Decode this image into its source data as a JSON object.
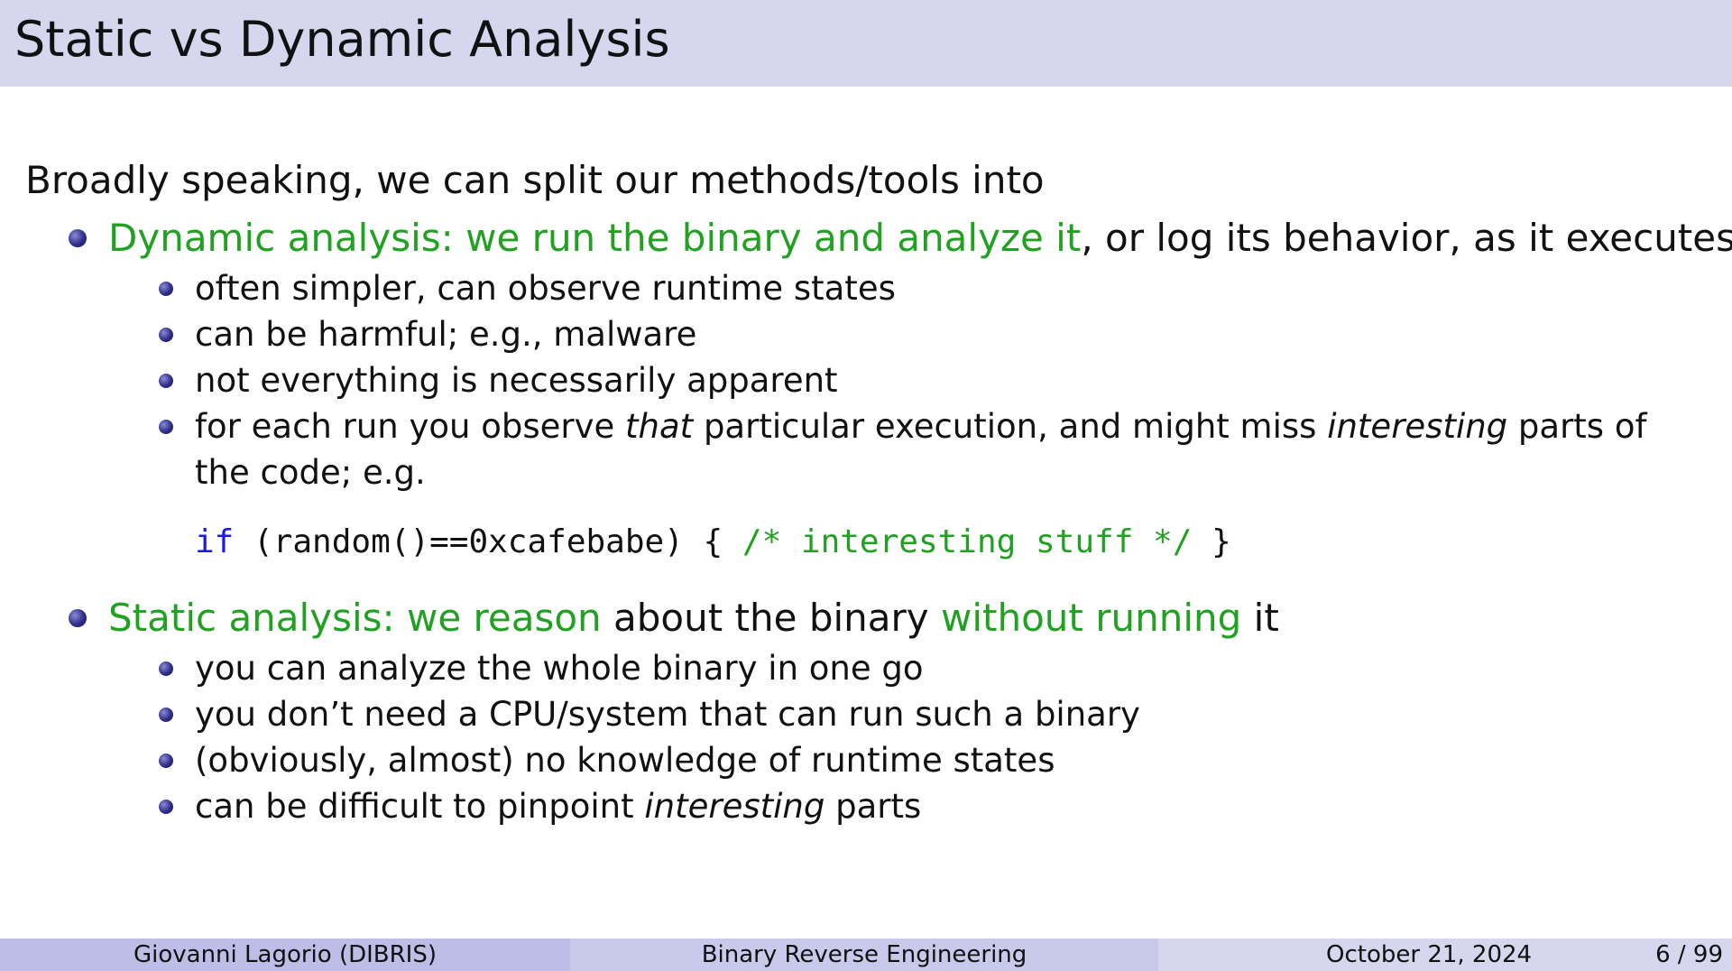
{
  "title": "Static vs Dynamic Analysis",
  "intro": "Broadly speaking, we can split our methods/tools into",
  "dynamic": {
    "label_colored": "Dynamic analysis: we run the binary and analyze it",
    "label_rest": ", or log its behavior, as it executes",
    "points": [
      "often simpler, can observe runtime states",
      "can be harmful; e.g., malware",
      "not everything is necessarily apparent"
    ],
    "last_point": {
      "part1": "for each run you observe ",
      "em1": "that",
      "part2": " particular execution, and might miss ",
      "em2": "interesting",
      "part3": " parts of the code; e.g."
    },
    "code": {
      "keyword": "if",
      "mid": " (random()==0xcafebabe) { ",
      "comment": "/* interesting stuff */",
      "end": " }"
    }
  },
  "static": {
    "label_colored_1": "Static analysis: we reason",
    "label_plain_1": " about the binary ",
    "label_colored_2": "without running",
    "label_plain_2": " it",
    "points": [
      "you can analyze the whole binary in one go",
      "you don’t need a CPU/system that can run such a binary",
      "(obviously, almost) no knowledge of runtime states"
    ],
    "last_point": {
      "part1": "can be difficult to pinpoint ",
      "em": "interesting",
      "part2": " parts"
    }
  },
  "footer": {
    "author": "Giovanni Lagorio  (DIBRIS)",
    "course": "Binary Reverse Engineering",
    "date": "October 21, 2024",
    "page": "6 / 99"
  },
  "colors": {
    "header_bg": "#d6d6ef",
    "highlight_green": "#21a121",
    "code_keyword_blue": "#1a1ae6",
    "bullet_navy": "#2d2d86"
  }
}
